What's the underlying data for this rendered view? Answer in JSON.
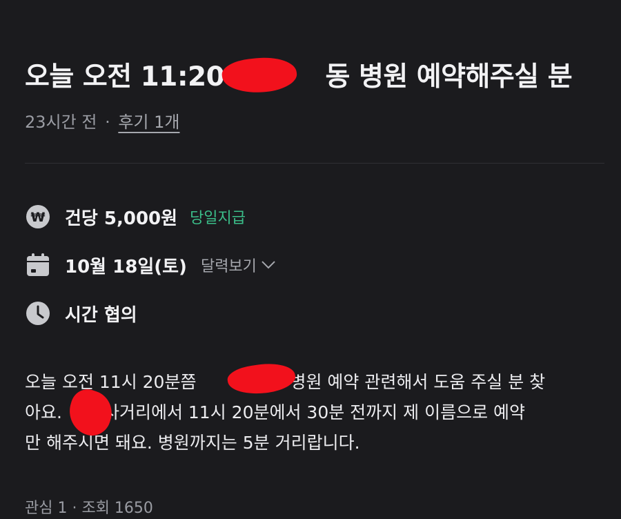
{
  "post": {
    "title": "오늘 오전 11:20 ~~~동 병원 예약해주실 분",
    "title_part1": "오늘 오전 11:20",
    "title_part2": "동 병원 예약해주실 분",
    "time_ago": "23시간 전",
    "separator": "·",
    "review_link": "후기 1개"
  },
  "details": {
    "pay": {
      "icon": "won-coin-icon",
      "text": "건당 5,000원",
      "badge": "당일지급",
      "badge_color": "#3bbf8a"
    },
    "date": {
      "icon": "calendar-icon",
      "text": "10월 18일(토)",
      "link": "달력보기"
    },
    "time": {
      "icon": "clock-icon",
      "text": "시간 협의"
    }
  },
  "description": {
    "line1_a": "오늘 오전 11시 20분쯤",
    "line1_b": "병원 예약 관련해서 도움 주실 분 찾",
    "line2_a": "아요.",
    "line2_b": "사거리에서 11시 20분에서 30분 전까지 제 이름으로 예약",
    "line3": "만 해주시면 돼요. 병원까지는 5분 거리랍니다."
  },
  "stats": {
    "text": "관심 1 · 조회 1650"
  },
  "colors": {
    "background": "#1b1b1e",
    "redaction": "#f2111c"
  }
}
